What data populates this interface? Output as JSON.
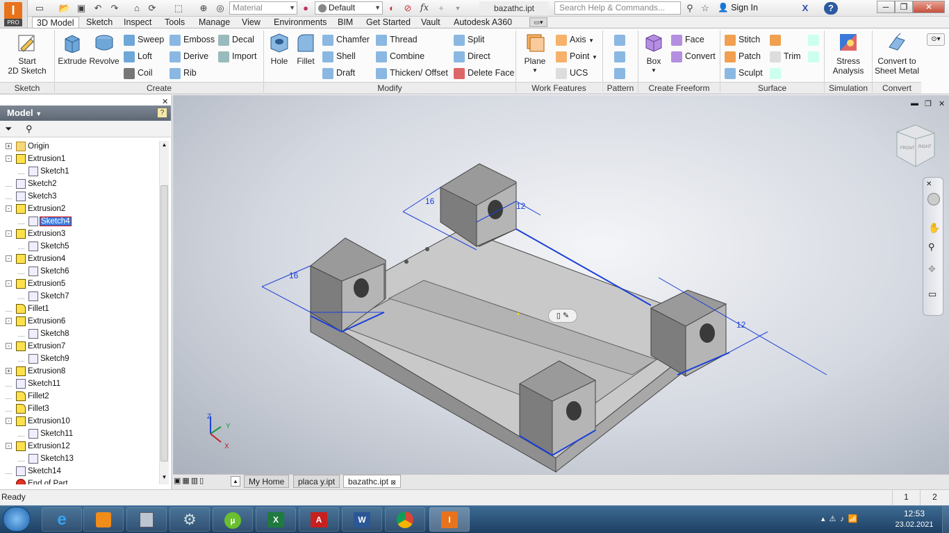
{
  "app": {
    "badge": "PRO",
    "logo_letter": "I"
  },
  "quick_access": {
    "material_placeholder": "Material",
    "appearance_value": "Default",
    "formula_icon": "fx"
  },
  "window": {
    "title": "bazathc.ipt"
  },
  "search": {
    "placeholder": "Search Help & Commands..."
  },
  "user": {
    "sign_in": "Sign In"
  },
  "tabs": [
    "3D Model",
    "Sketch",
    "Inspect",
    "Tools",
    "Manage",
    "View",
    "Environments",
    "BIM",
    "Get Started",
    "Vault",
    "Autodesk A360"
  ],
  "ribbon": {
    "sketch": {
      "start_line1": "Start",
      "start_line2": "2D Sketch",
      "label": "Sketch"
    },
    "create": {
      "extrude": "Extrude",
      "revolve": "Revolve",
      "sweep": "Sweep",
      "emboss": "Emboss",
      "decal": "Decal",
      "loft": "Loft",
      "derive": "Derive",
      "import": "Import",
      "coil": "Coil",
      "rib": "Rib",
      "label": "Create"
    },
    "modify": {
      "hole": "Hole",
      "fillet": "Fillet",
      "chamfer": "Chamfer",
      "thread": "Thread",
      "split": "Split",
      "shell": "Shell",
      "combine": "Combine",
      "direct": "Direct",
      "draft": "Draft",
      "thicken": "Thicken/ Offset",
      "delete_face": "Delete Face",
      "label": "Modify"
    },
    "work": {
      "plane": "Plane",
      "axis": "Axis",
      "point": "Point",
      "ucs": "UCS",
      "label": "Work Features"
    },
    "pattern": {
      "label": "Pattern"
    },
    "freeform": {
      "box": "Box",
      "face": "Face",
      "convert": "Convert",
      "label": "Create Freeform"
    },
    "surface": {
      "stitch": "Stitch",
      "patch": "Patch",
      "trim": "Trim",
      "sculpt": "Sculpt",
      "label": "Surface"
    },
    "simulation": {
      "line1": "Stress",
      "line2": "Analysis",
      "label": "Simulation"
    },
    "convert": {
      "line1": "Convert to",
      "line2": "Sheet Metal",
      "label": "Convert"
    }
  },
  "browser": {
    "title": "Model",
    "items": [
      {
        "label": "Origin",
        "level": 0,
        "icon": "folder-icon",
        "expand": "+"
      },
      {
        "label": "Extrusion1",
        "level": 0,
        "icon": "extrusion-icon",
        "expand": "-"
      },
      {
        "label": "Sketch1",
        "level": 1,
        "icon": "sketch-icon",
        "expand": ""
      },
      {
        "label": "Sketch2",
        "level": 0,
        "icon": "sketch-icon",
        "expand": ""
      },
      {
        "label": "Sketch3",
        "level": 0,
        "icon": "sketch-icon",
        "expand": ""
      },
      {
        "label": "Extrusion2",
        "level": 0,
        "icon": "extrusion-icon",
        "expand": "-"
      },
      {
        "label": "Sketch4",
        "level": 1,
        "icon": "sketch-icon",
        "expand": "",
        "selected": true
      },
      {
        "label": "Extrusion3",
        "level": 0,
        "icon": "extrusion-icon",
        "expand": "-"
      },
      {
        "label": "Sketch5",
        "level": 1,
        "icon": "sketch-icon",
        "expand": ""
      },
      {
        "label": "Extrusion4",
        "level": 0,
        "icon": "extrusion-icon",
        "expand": "-"
      },
      {
        "label": "Sketch6",
        "level": 1,
        "icon": "sketch-icon",
        "expand": ""
      },
      {
        "label": "Extrusion5",
        "level": 0,
        "icon": "extrusion-icon",
        "expand": "-"
      },
      {
        "label": "Sketch7",
        "level": 1,
        "icon": "sketch-icon",
        "expand": ""
      },
      {
        "label": "Fillet1",
        "level": 0,
        "icon": "fillet-icon",
        "expand": ""
      },
      {
        "label": "Extrusion6",
        "level": 0,
        "icon": "extrusion-icon",
        "expand": "-"
      },
      {
        "label": "Sketch8",
        "level": 1,
        "icon": "sketch-icon",
        "expand": ""
      },
      {
        "label": "Extrusion7",
        "level": 0,
        "icon": "extrusion-icon",
        "expand": "-"
      },
      {
        "label": "Sketch9",
        "level": 1,
        "icon": "sketch-icon",
        "expand": ""
      },
      {
        "label": "Extrusion8",
        "level": 0,
        "icon": "extrusion-icon",
        "expand": "+"
      },
      {
        "label": "Sketch11",
        "level": 0,
        "icon": "sketch-icon",
        "expand": ""
      },
      {
        "label": "Fillet2",
        "level": 0,
        "icon": "fillet-icon",
        "expand": ""
      },
      {
        "label": "Fillet3",
        "level": 0,
        "icon": "fillet-icon",
        "expand": ""
      },
      {
        "label": "Extrusion10",
        "level": 0,
        "icon": "extrusion-icon",
        "expand": "-"
      },
      {
        "label": "Sketch11",
        "level": 1,
        "icon": "sketch-icon",
        "expand": ""
      },
      {
        "label": "Extrusion12",
        "level": 0,
        "icon": "extrusion-icon",
        "expand": "-"
      },
      {
        "label": "Sketch13",
        "level": 1,
        "icon": "sketch-icon",
        "expand": ""
      },
      {
        "label": "Sketch14",
        "level": 0,
        "icon": "sketch-icon",
        "expand": ""
      },
      {
        "label": "End of Part",
        "level": 0,
        "icon": "end-of-part-icon",
        "expand": ""
      }
    ]
  },
  "viewport": {
    "dimensions": [
      "16",
      "12",
      "16",
      "12"
    ],
    "viewcube_labels": [
      "FRONT",
      "RIGHT"
    ],
    "triad": {
      "x": "X",
      "y": "Y",
      "z": "Z"
    }
  },
  "doc_tabs": [
    "My Home",
    "placa y.ipt",
    "bazathc.ipt"
  ],
  "status": {
    "text": "Ready",
    "count1": "1",
    "count2": "2"
  },
  "taskbar": {
    "time": "12:53",
    "date": "23.02.2021",
    "pinned": [
      "ie-icon",
      "media-player-icon",
      "calculator-icon",
      "settings-icon",
      "utorrent-icon",
      "excel-icon",
      "acrobat-icon",
      "word-icon",
      "chrome-icon",
      "inventor-icon"
    ]
  },
  "colors": {
    "accent": "#e8731c",
    "dimension_blue": "#1a3fd9",
    "selection_blue": "#3b7ee1"
  }
}
